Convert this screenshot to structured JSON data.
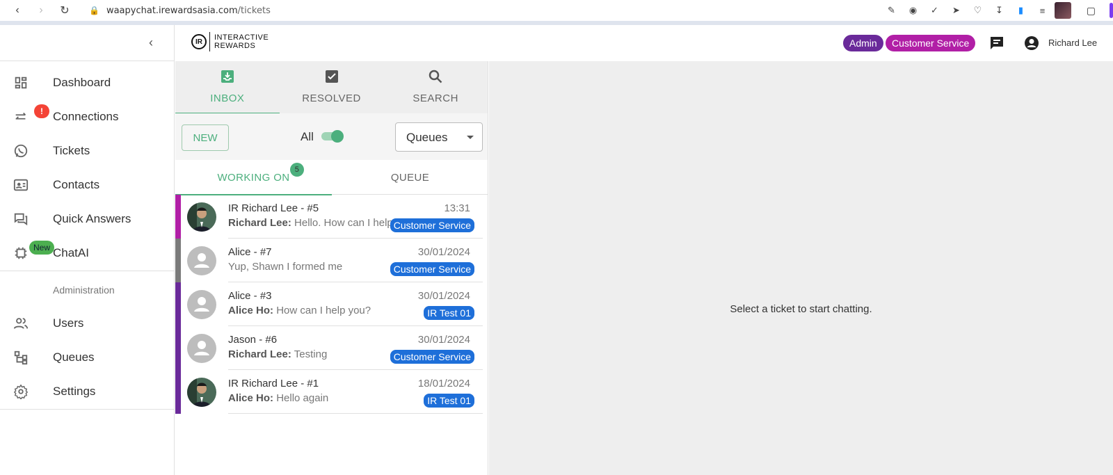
{
  "browser": {
    "url_host": "waapychat.irewardsasia.com",
    "url_path": "/tickets"
  },
  "header": {
    "logo_mark": "IR",
    "logo_line1": "INTERACTIVE",
    "logo_line2": "REWARDS",
    "roles": [
      "Admin",
      "Customer Service"
    ],
    "user_name": "Richard Lee"
  },
  "sidebar": {
    "items": [
      {
        "label": "Dashboard",
        "icon": "dashboard-icon"
      },
      {
        "label": "Connections",
        "icon": "swap-icon",
        "badge": "!"
      },
      {
        "label": "Tickets",
        "icon": "whatsapp-icon"
      },
      {
        "label": "Contacts",
        "icon": "contact-card-icon"
      },
      {
        "label": "Quick Answers",
        "icon": "forum-icon"
      },
      {
        "label": "ChatAI",
        "icon": "chip-icon",
        "badge": "New"
      }
    ],
    "section_label": "Administration",
    "admin_items": [
      {
        "label": "Users",
        "icon": "people-icon"
      },
      {
        "label": "Queues",
        "icon": "hierarchy-icon"
      },
      {
        "label": "Settings",
        "icon": "gear-icon"
      }
    ]
  },
  "tickets_panel": {
    "tabs": [
      {
        "label": "INBOX",
        "icon": "inbox-icon",
        "active": true
      },
      {
        "label": "RESOLVED",
        "icon": "check-box-icon",
        "active": false
      },
      {
        "label": "SEARCH",
        "icon": "search-icon",
        "active": false
      }
    ],
    "new_button": "NEW",
    "all_label": "All",
    "all_toggle_on": true,
    "queues_select": "Queues",
    "subtabs": {
      "working": "WORKING ON",
      "working_count": "5",
      "queue": "QUEUE"
    },
    "tickets": [
      {
        "name": "IR Richard Lee - #5",
        "time": "13:31",
        "sender": "Richard Lee:",
        "message": "Hello. How can I help",
        "tag": "Customer Service",
        "stripe": "#b11fa6",
        "avatar": "photo"
      },
      {
        "name": "Alice - #7",
        "time": "30/01/2024",
        "sender": "",
        "message": "Yup, Shawn I formed me",
        "tag": "Customer Service",
        "stripe": "#7a7a7a",
        "avatar": "default"
      },
      {
        "name": "Alice - #3",
        "time": "30/01/2024",
        "sender": "Alice Ho:",
        "message": "How can I help you?",
        "tag": "IR Test 01",
        "stripe": "#6a2a9a",
        "avatar": "default"
      },
      {
        "name": "Jason - #6",
        "time": "30/01/2024",
        "sender": "Richard Lee:",
        "message": "Testing",
        "tag": "Customer Service",
        "stripe": "#6a2a9a",
        "avatar": "default"
      },
      {
        "name": "IR Richard Lee - #1",
        "time": "18/01/2024",
        "sender": "Alice Ho:",
        "message": "Hello again",
        "tag": "IR Test 01",
        "stripe": "#6a2a9a",
        "avatar": "photo"
      }
    ]
  },
  "chat_area": {
    "empty_message": "Select a ticket to start chatting."
  },
  "colors": {
    "accent_green": "#4caf7d",
    "admin_badge": "#6a2a9a",
    "cs_badge": "#b11fa6",
    "queue_tag": "#1e6fd9"
  }
}
